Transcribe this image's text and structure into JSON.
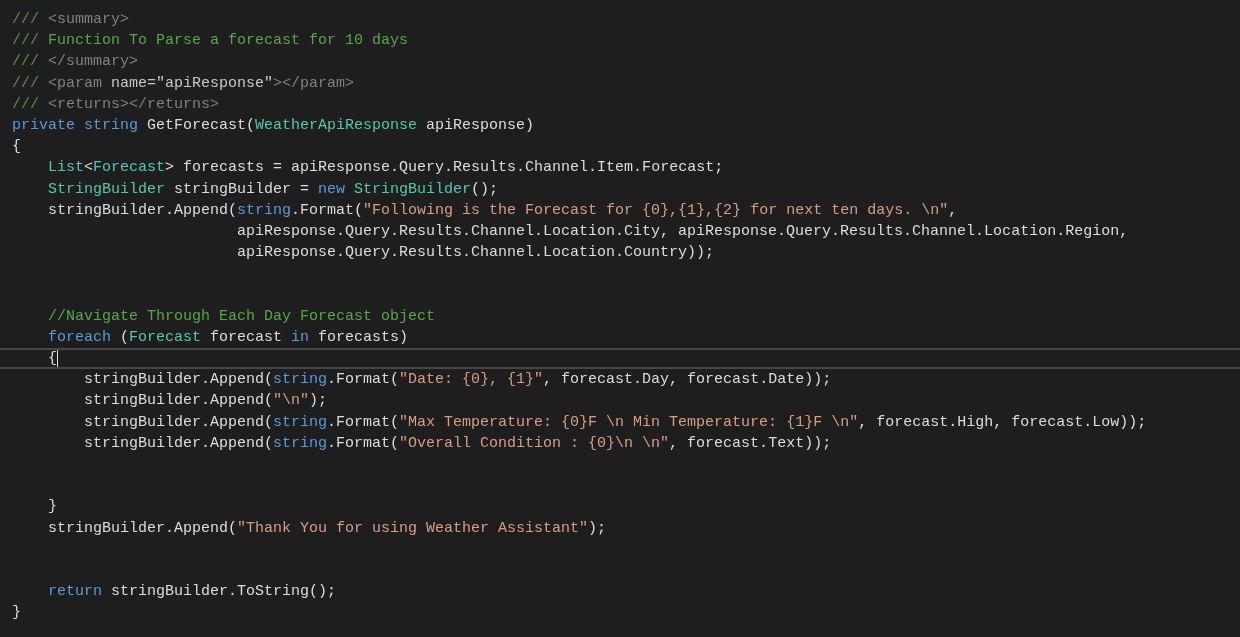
{
  "editor": {
    "lines": [
      {
        "current": false,
        "tokens": [
          {
            "kind": "doc-delim",
            "text": "///"
          },
          {
            "kind": "doc-tag",
            "text": " <summary>"
          }
        ]
      },
      {
        "current": false,
        "tokens": [
          {
            "kind": "doc-delim",
            "text": "///"
          },
          {
            "kind": "doc-text",
            "text": " Function To Parse a forecast for 10 days"
          }
        ]
      },
      {
        "current": false,
        "tokens": [
          {
            "kind": "doc-delim",
            "text": "///"
          },
          {
            "kind": "doc-tag",
            "text": " </summary>"
          }
        ]
      },
      {
        "current": false,
        "tokens": [
          {
            "kind": "doc-delim",
            "text": "///"
          },
          {
            "kind": "doc-tag",
            "text": " <param "
          },
          {
            "kind": "doc-attr",
            "text": "name=\"apiResponse\""
          },
          {
            "kind": "doc-tag",
            "text": "></param>"
          }
        ]
      },
      {
        "current": false,
        "tokens": [
          {
            "kind": "doc-delim",
            "text": "///"
          },
          {
            "kind": "doc-tag",
            "text": " <returns></returns>"
          }
        ]
      },
      {
        "current": false,
        "tokens": [
          {
            "kind": "keyword",
            "text": "private string"
          },
          {
            "kind": "plain",
            "text": " GetForecast("
          },
          {
            "kind": "type",
            "text": "WeatherApiResponse"
          },
          {
            "kind": "plain",
            "text": " apiResponse)"
          }
        ]
      },
      {
        "current": false,
        "tokens": [
          {
            "kind": "plain",
            "text": "{"
          }
        ]
      },
      {
        "current": false,
        "tokens": [
          {
            "kind": "type",
            "text": "    List"
          },
          {
            "kind": "plain",
            "text": "<"
          },
          {
            "kind": "type",
            "text": "Forecast"
          },
          {
            "kind": "plain",
            "text": "> forecasts = apiResponse.Query.Results.Channel.Item.Forecast;"
          }
        ]
      },
      {
        "current": false,
        "tokens": [
          {
            "kind": "type",
            "text": "    StringBuilder"
          },
          {
            "kind": "plain",
            "text": " stringBuilder = "
          },
          {
            "kind": "keyword",
            "text": "new"
          },
          {
            "kind": "type",
            "text": " StringBuilder"
          },
          {
            "kind": "plain",
            "text": "();"
          }
        ]
      },
      {
        "current": false,
        "tokens": [
          {
            "kind": "plain",
            "text": "    stringBuilder.Append("
          },
          {
            "kind": "keyword",
            "text": "string"
          },
          {
            "kind": "plain",
            "text": ".Format("
          },
          {
            "kind": "string",
            "text": "\"Following is the Forecast for {0},{1},{2} for next ten days. \\n\""
          },
          {
            "kind": "plain",
            "text": ","
          }
        ]
      },
      {
        "current": false,
        "tokens": [
          {
            "kind": "plain",
            "text": "                         apiResponse.Query.Results.Channel.Location.City, apiResponse.Query.Results.Channel.Location.Region,"
          }
        ]
      },
      {
        "current": false,
        "tokens": [
          {
            "kind": "plain",
            "text": "                         apiResponse.Query.Results.Channel.Location.Country));"
          }
        ]
      },
      {
        "current": false
      },
      {
        "current": false
      },
      {
        "current": false,
        "tokens": [
          {
            "kind": "comment",
            "text": "    //Navigate Through Each Day Forecast object"
          }
        ]
      },
      {
        "current": false,
        "tokens": [
          {
            "kind": "keyword",
            "text": "    foreach"
          },
          {
            "kind": "plain",
            "text": " ("
          },
          {
            "kind": "type",
            "text": "Forecast"
          },
          {
            "kind": "plain",
            "text": " forecast "
          },
          {
            "kind": "keyword",
            "text": "in"
          },
          {
            "kind": "plain",
            "text": " forecasts)"
          }
        ]
      },
      {
        "current": true,
        "tokens": [
          {
            "kind": "plain",
            "text": "    {"
          }
        ]
      },
      {
        "current": false,
        "tokens": [
          {
            "kind": "plain",
            "text": "        stringBuilder.Append("
          },
          {
            "kind": "keyword",
            "text": "string"
          },
          {
            "kind": "plain",
            "text": ".Format("
          },
          {
            "kind": "string",
            "text": "\"Date: {0}, {1}\""
          },
          {
            "kind": "plain",
            "text": ", forecast.Day, forecast.Date));"
          }
        ]
      },
      {
        "current": false,
        "tokens": [
          {
            "kind": "plain",
            "text": "        stringBuilder.Append("
          },
          {
            "kind": "string",
            "text": "\"\\n\""
          },
          {
            "kind": "plain",
            "text": ");"
          }
        ]
      },
      {
        "current": false,
        "tokens": [
          {
            "kind": "plain",
            "text": "        stringBuilder.Append("
          },
          {
            "kind": "keyword",
            "text": "string"
          },
          {
            "kind": "plain",
            "text": ".Format("
          },
          {
            "kind": "string",
            "text": "\"Max Temperature: {0}F \\n Min Temperature: {1}F \\n\""
          },
          {
            "kind": "plain",
            "text": ", forecast.High, forecast.Low));"
          }
        ]
      },
      {
        "current": false,
        "tokens": [
          {
            "kind": "plain",
            "text": "        stringBuilder.Append("
          },
          {
            "kind": "keyword",
            "text": "string"
          },
          {
            "kind": "plain",
            "text": ".Format("
          },
          {
            "kind": "string",
            "text": "\"Overall Condition : {0}\\n \\n\""
          },
          {
            "kind": "plain",
            "text": ", forecast.Text));"
          }
        ]
      },
      {
        "current": false
      },
      {
        "current": false
      },
      {
        "current": false,
        "tokens": [
          {
            "kind": "plain",
            "text": "    }"
          }
        ]
      },
      {
        "current": false,
        "tokens": [
          {
            "kind": "plain",
            "text": "    stringBuilder.Append("
          },
          {
            "kind": "string",
            "text": "\"Thank You for using Weather Assistant\""
          },
          {
            "kind": "plain",
            "text": ");"
          }
        ]
      },
      {
        "current": false
      },
      {
        "current": false
      },
      {
        "current": false,
        "tokens": [
          {
            "kind": "keyword",
            "text": "    return"
          },
          {
            "kind": "plain",
            "text": " stringBuilder.ToString();"
          }
        ]
      },
      {
        "current": false,
        "tokens": [
          {
            "kind": "plain",
            "text": "}"
          }
        ]
      }
    ]
  }
}
